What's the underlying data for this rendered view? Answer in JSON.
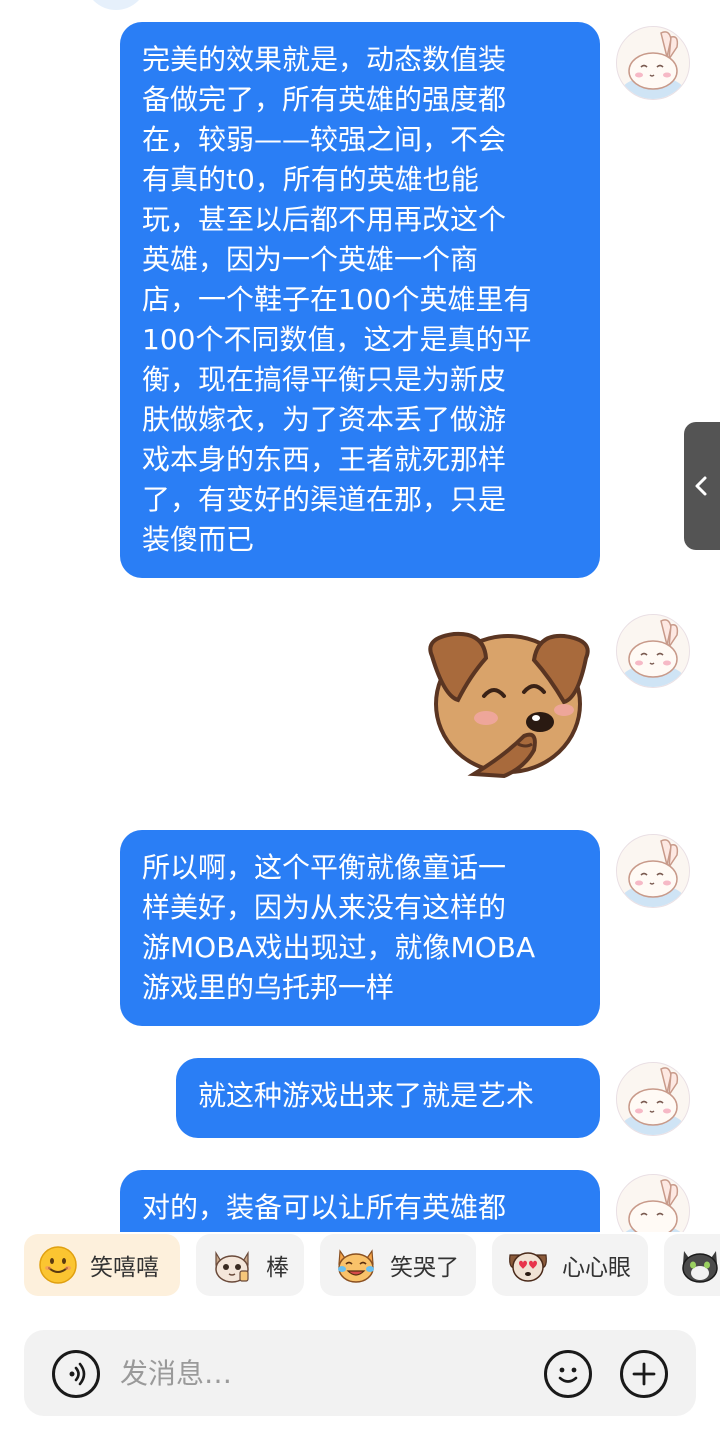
{
  "chat": {
    "messages": [
      {
        "type": "text",
        "text": "完美的效果就是，动态数值装\n备做完了，所有英雄的强度都\n在，较弱——较强之间，不会\n有真的t0，所有的英雄也能\n玩，甚至以后都不用再改这个\n英雄，因为一个英雄一个商\n店，一个鞋子在100个英雄里有\n100个不同数值，这才是真的平\n衡，现在搞得平衡只是为新皮\n肤做嫁衣，为了资本丢了做游\n戏本身的东西，王者就死那样\n了，有变好的渠道在那，只是\n装傻而已"
      },
      {
        "type": "sticker",
        "sticker": "dog-covering-mouth-laughing"
      },
      {
        "type": "text",
        "text": "所以啊，这个平衡就像童话一\n样美好，因为从来没有这样的\n游MOBA戏出现过，就像MOBA\n游戏里的乌托邦一样"
      },
      {
        "type": "text",
        "text": "就这种游戏出来了就是艺术"
      },
      {
        "type": "text",
        "text": "对的，装备可以让所有英雄都"
      }
    ]
  },
  "quick_reactions": [
    {
      "icon": "grinning-face-icon",
      "label": "笑嘻嘻"
    },
    {
      "icon": "cat-thumbs-up-icon",
      "label": "棒"
    },
    {
      "icon": "cat-tears-of-joy-icon",
      "label": "笑哭了"
    },
    {
      "icon": "dog-heart-eyes-icon",
      "label": "心心眼"
    },
    {
      "icon": "cat-icon",
      "label": ""
    }
  ],
  "composer": {
    "placeholder": "发消息…",
    "voice_icon": "voice-icon",
    "emoji_icon": "emoji-icon",
    "add_icon": "plus-icon"
  },
  "colors": {
    "bubble": "#2a7ef5",
    "bubble_text": "#ffffff",
    "chip_bg": "#f3f3f3",
    "chip_active_bg": "#fdf0dc",
    "input_bg": "#f2f2f2"
  }
}
